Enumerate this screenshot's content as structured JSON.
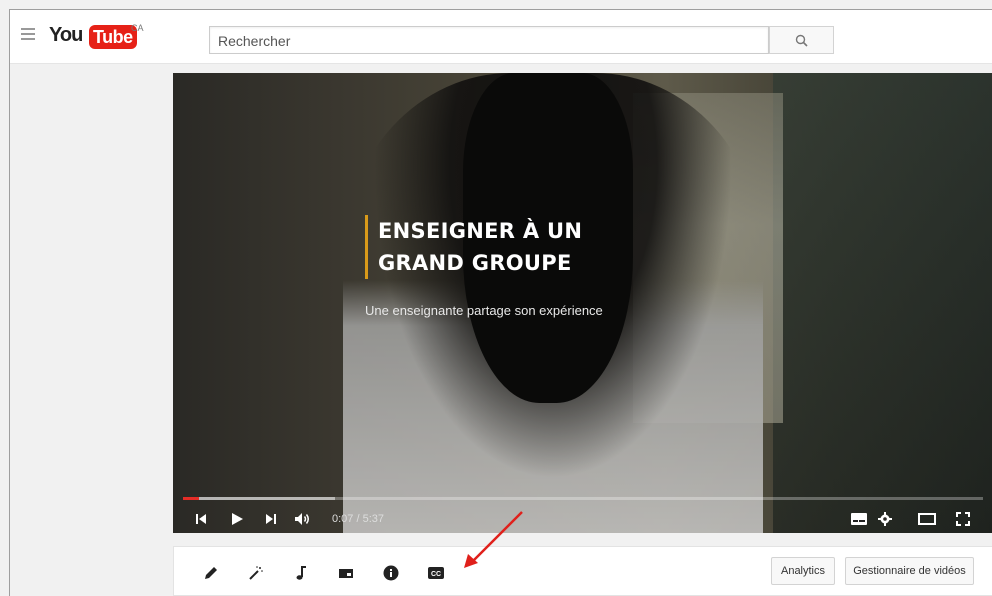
{
  "header": {
    "logo_you": "You",
    "logo_tube": "Tube",
    "region": "CA",
    "search_placeholder": "Rechercher"
  },
  "video": {
    "title_lines": [
      "ENSEIGNER À UN",
      "GRAND GROUPE"
    ],
    "subtitle": "Une enseignante partage son expérience",
    "time_current": "0:07",
    "time_total": "5:37",
    "time_display": "0:07 / 5:37",
    "progress_played": 0.02,
    "progress_buffered": 0.19
  },
  "toolbar": {
    "icons": [
      "pencil-icon",
      "magic-wand-icon",
      "music-note-icon",
      "card-icon",
      "info-icon",
      "closed-caption-icon"
    ],
    "analytics_label": "Analytics",
    "video_manager_label": "Gestionnaire de vidéos"
  },
  "colors": {
    "youtube_red": "#e62117",
    "progress_red": "#e52d27",
    "title_accent": "#d99a1a",
    "annotation_arrow": "#e0201b"
  }
}
